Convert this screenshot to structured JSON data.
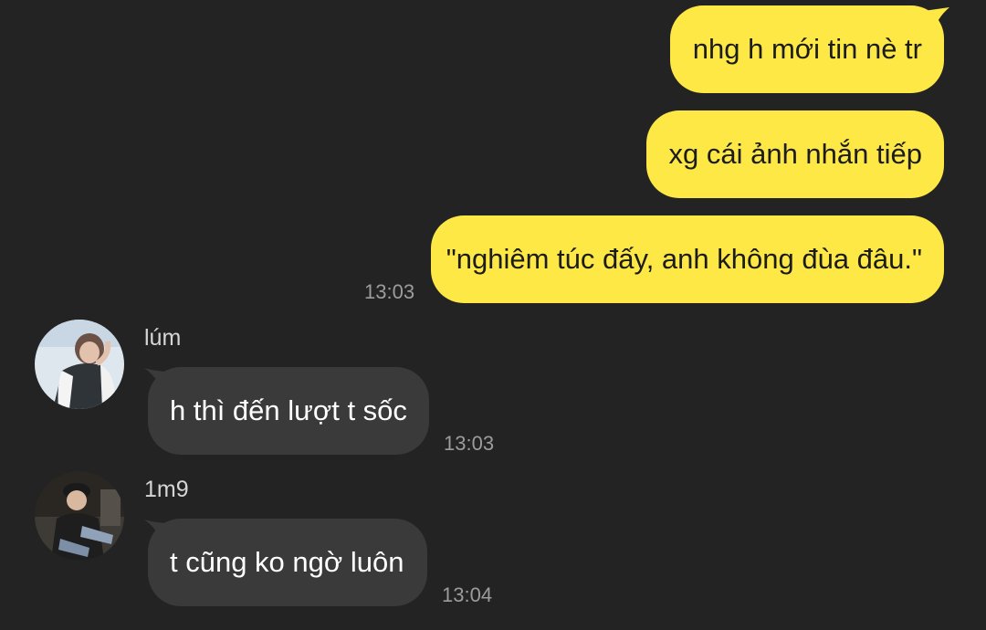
{
  "chat": {
    "colors": {
      "background": "#232323",
      "outgoing_bubble": "#fde845",
      "incoming_bubble": "#3a3a3a",
      "timestamp": "#9c9c9c"
    },
    "outgoing": [
      {
        "text": "nhg h mới tin nè tr"
      },
      {
        "text": "xg cái ảnh nhắn tiếp"
      },
      {
        "text": "\"nghiêm túc đấy, anh không đùa đâu.\"",
        "time": "13:03"
      }
    ],
    "incoming": [
      {
        "sender": "lúm",
        "text": "h thì đến lượt t sốc",
        "time": "13:03",
        "avatar_icon": "avatar-photo-icon"
      },
      {
        "sender": "1m9",
        "text": "t cũng ko ngờ luôn",
        "time": "13:04",
        "avatar_icon": "avatar-photo-icon"
      }
    ]
  }
}
